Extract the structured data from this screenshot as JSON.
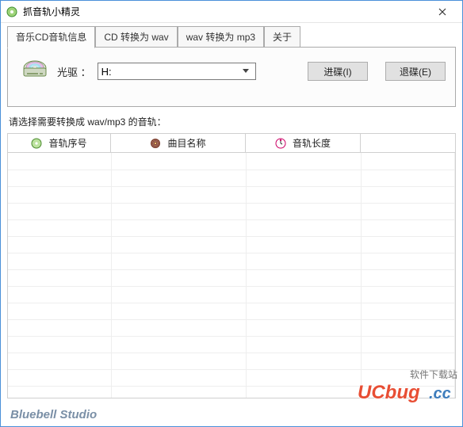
{
  "window": {
    "title": "抓音轨小精灵"
  },
  "tabs": [
    {
      "label": "音乐CD音轨信息",
      "active": true
    },
    {
      "label": "CD 转换为 wav",
      "active": false
    },
    {
      "label": "wav 转换为 mp3",
      "active": false
    },
    {
      "label": "关于",
      "active": false
    }
  ],
  "drive": {
    "label": "光驱 ：",
    "selected": "H:",
    "options": [
      "H:"
    ],
    "load_btn": "进碟(I)",
    "eject_btn": "退碟(E)"
  },
  "hint": "请选择需要转换成 wav/mp3 的音轨：",
  "columns": {
    "track_no": "音轨序号",
    "track_title": "曲目名称",
    "track_length": "音轨长度"
  },
  "rows": [],
  "footer": "Bluebell Studio",
  "watermark": {
    "line1": "软件下载站",
    "line2": "UCbug.cc"
  }
}
